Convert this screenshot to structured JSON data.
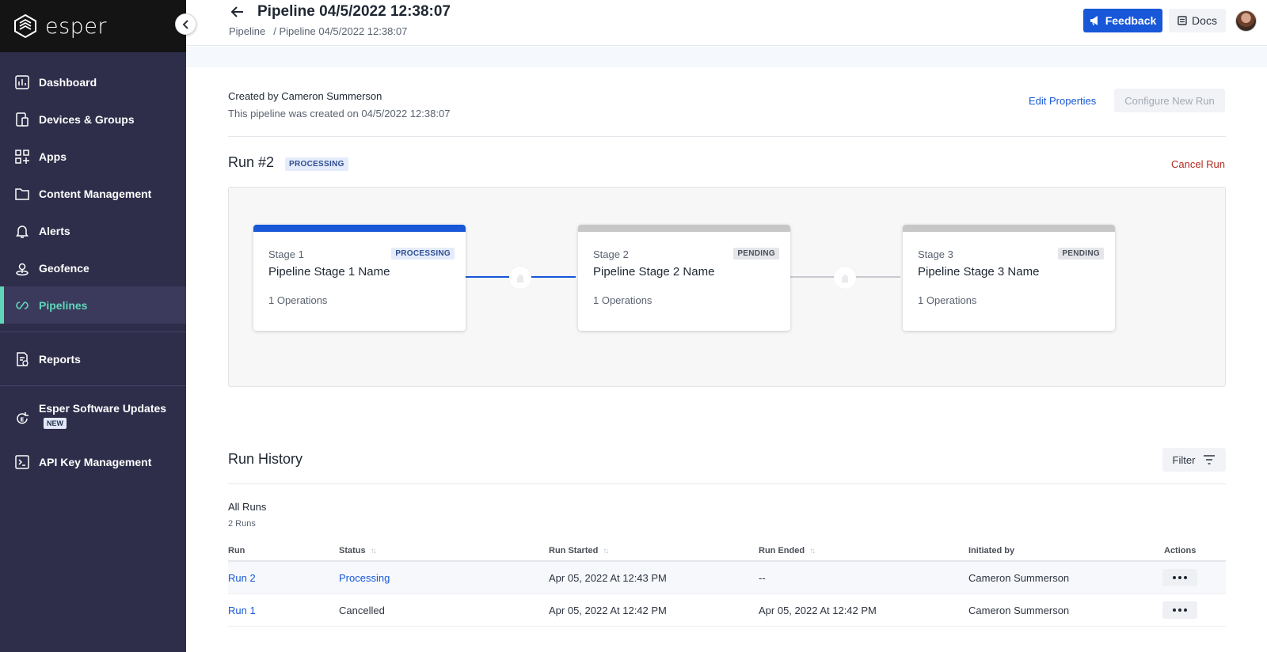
{
  "app": {
    "brand": "esper"
  },
  "sidebar": {
    "items": [
      {
        "label": "Dashboard",
        "icon": "dashboard-icon"
      },
      {
        "label": "Devices & Groups",
        "icon": "devices-icon"
      },
      {
        "label": "Apps",
        "icon": "apps-icon"
      },
      {
        "label": "Content Management",
        "icon": "folder-icon"
      },
      {
        "label": "Alerts",
        "icon": "bell-icon"
      },
      {
        "label": "Geofence",
        "icon": "geofence-icon"
      },
      {
        "label": "Pipelines",
        "icon": "pipelines-icon",
        "active": true
      },
      {
        "label": "Reports",
        "icon": "reports-icon"
      },
      {
        "label": "Esper Software Updates",
        "icon": "software-updates-icon",
        "badge": "NEW"
      },
      {
        "label": "API Key Management",
        "icon": "terminal-icon"
      }
    ]
  },
  "header": {
    "title": "Pipeline 04/5/2022 12:38:07",
    "breadcrumb": [
      "Pipeline",
      "/ Pipeline 04/5/2022 12:38:07"
    ],
    "feedback_label": "Feedback",
    "docs_label": "Docs"
  },
  "pipeline": {
    "created_by": "Created by Cameron Summerson",
    "created_on": "This pipeline was created on 04/5/2022 12:38:07",
    "edit_label": "Edit Properties",
    "configure_label": "Configure New Run"
  },
  "run": {
    "title": "Run #2",
    "status": "PROCESSING",
    "cancel_label": "Cancel Run",
    "stages": [
      {
        "label": "Stage 1",
        "name": "Pipeline Stage 1 Name",
        "ops": "1 Operations",
        "status": "PROCESSING"
      },
      {
        "label": "Stage 2",
        "name": "Pipeline Stage 2 Name",
        "ops": "1 Operations",
        "status": "PENDING"
      },
      {
        "label": "Stage 3",
        "name": "Pipeline Stage 3 Name",
        "ops": "1 Operations",
        "status": "PENDING"
      }
    ]
  },
  "history": {
    "title": "Run History",
    "filter_label": "Filter",
    "all_runs": "All Runs",
    "count": "2 Runs",
    "columns": [
      "Run",
      "Status",
      "Run Started",
      "Run Ended",
      "Initiated by",
      "Actions"
    ],
    "rows": [
      {
        "run": "Run 2",
        "status": "Processing",
        "started": "Apr 05, 2022 At 12:43 PM",
        "ended": "--",
        "initiated_by": "Cameron Summerson"
      },
      {
        "run": "Run 1",
        "status": "Cancelled",
        "started": "Apr 05, 2022 At 12:42 PM",
        "ended": "Apr 05, 2022 At 12:42 PM",
        "initiated_by": "Cameron Summerson"
      }
    ]
  },
  "colors": {
    "sidebar_bg": "#2e2d4a",
    "accent_green": "#5fd6b9",
    "primary_blue": "#1757d8",
    "cancel_red": "#b22a1f"
  }
}
